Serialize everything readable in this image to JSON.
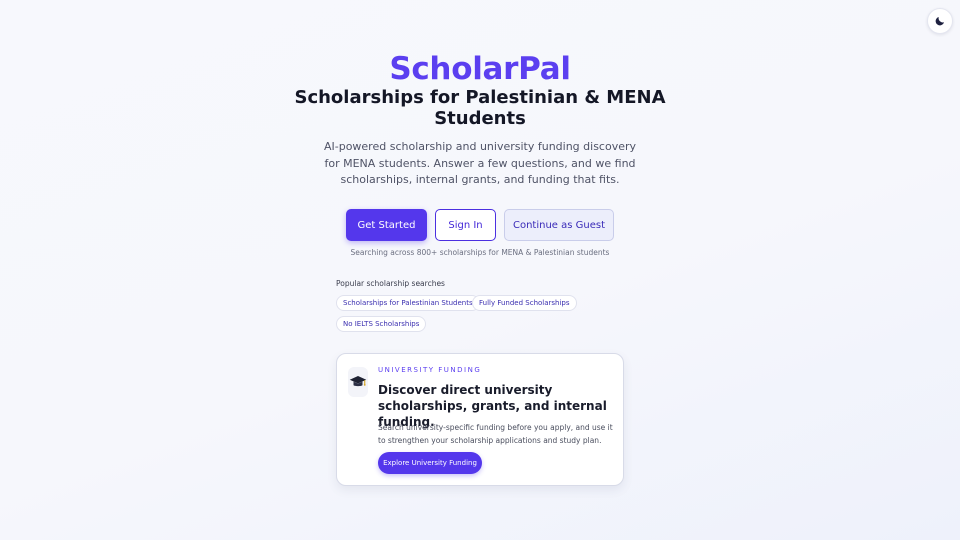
{
  "theme_toggle": {
    "icon": "moon-icon"
  },
  "hero": {
    "brand": "ScholarPal",
    "headline": "Scholarships for Palestinian & MENA Students",
    "subtitle": "AI-powered scholarship and university funding discovery for MENA students. Answer a few questions, and we find scholarships, internal grants, and funding that fits."
  },
  "actions": {
    "get_started": "Get Started",
    "sign_in": "Sign In",
    "guest": "Continue as Guest"
  },
  "search_note": "Searching across 800+ scholarships for MENA & Palestinian students",
  "popular": {
    "title": "Popular scholarship searches",
    "chips": [
      "Scholarships for Palestinian Students",
      "Fully Funded Scholarships",
      "No IELTS Scholarships"
    ]
  },
  "funding_card": {
    "icon": "graduation-cap-icon",
    "eyebrow": "UNIVERSITY FUNDING",
    "title": "Discover direct university scholarships, grants, and internal funding.",
    "body": "Search university-specific funding before you apply, and use it to strengthen your scholarship applications and study plan.",
    "button": "Explore University Funding"
  },
  "colors": {
    "accent": "#5b3ff0",
    "primary_button": "#5437ec",
    "background": "#f6f7fc"
  }
}
